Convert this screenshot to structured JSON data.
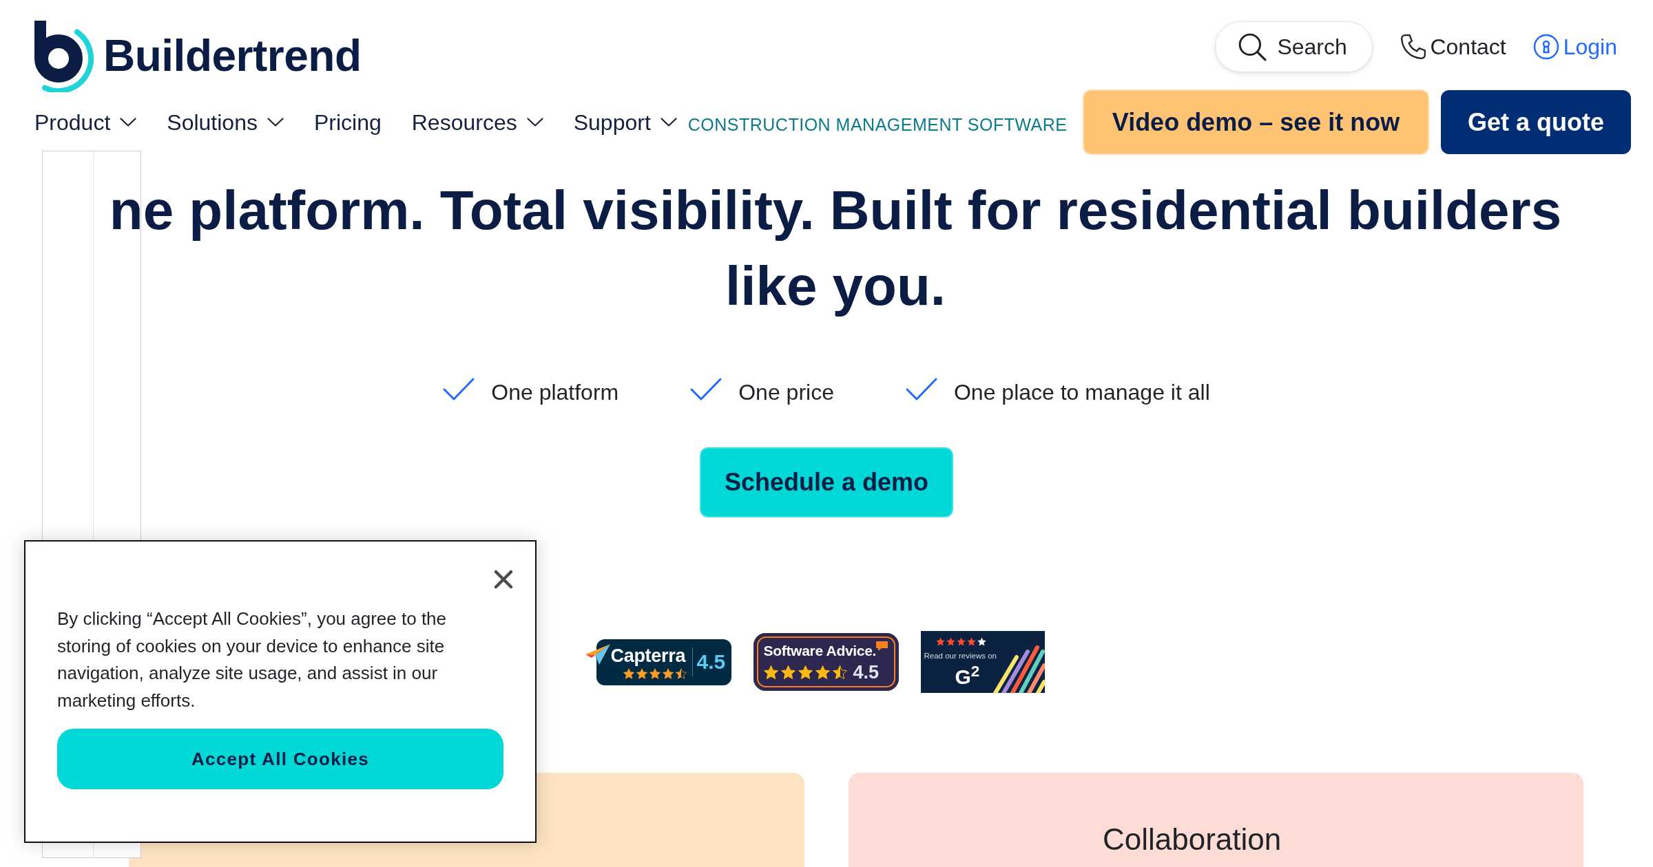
{
  "header": {
    "brand": "Buildertrend",
    "search_label": "Search",
    "links": [
      {
        "kind": "contact",
        "label": "Contact"
      },
      {
        "kind": "login",
        "label": "Login"
      }
    ]
  },
  "nav": {
    "items": [
      {
        "label": "Product",
        "has_menu": true
      },
      {
        "label": "Solutions",
        "has_menu": true
      },
      {
        "label": "Pricing",
        "has_menu": false
      },
      {
        "label": "Resources",
        "has_menu": true
      },
      {
        "label": "Support",
        "has_menu": true
      }
    ],
    "tagline": "CONSTRUCTION MANAGEMENT SOFTWARE",
    "buttons": [
      {
        "kind": "secondary",
        "label": "Video demo – see it now"
      },
      {
        "kind": "primary",
        "label": "Get a quote"
      }
    ]
  },
  "hero": {
    "heading": "ne platform. Total visibility. Built for residential builders like you.",
    "benefits": [
      "One platform",
      "One price",
      "One place to manage it all"
    ],
    "cta": "Schedule a demo"
  },
  "review_badges": [
    {
      "kind": "capterra",
      "name": "Capterra",
      "stars": 4.5,
      "score": "4.5"
    },
    {
      "kind": "software_advice",
      "name": "Software Advice.",
      "stars": 4.5,
      "score": "4.5"
    },
    {
      "kind": "g2",
      "caption": "Read our reviews on",
      "logo": "G$^{2}$",
      "stars": 4
    }
  ],
  "feature_cards": [
    {
      "color": "#fde3c1"
    },
    {
      "title": "Collaboration",
      "color": "#fddcd6"
    }
  ],
  "cookie_banner": {
    "message": "By clicking “Accept All Cookies”, you agree to the storing of cookies on your device to enhance site navigation, analyze site usage, and assist in our marketing efforts.",
    "accept_label": "Accept All Cookies"
  }
}
